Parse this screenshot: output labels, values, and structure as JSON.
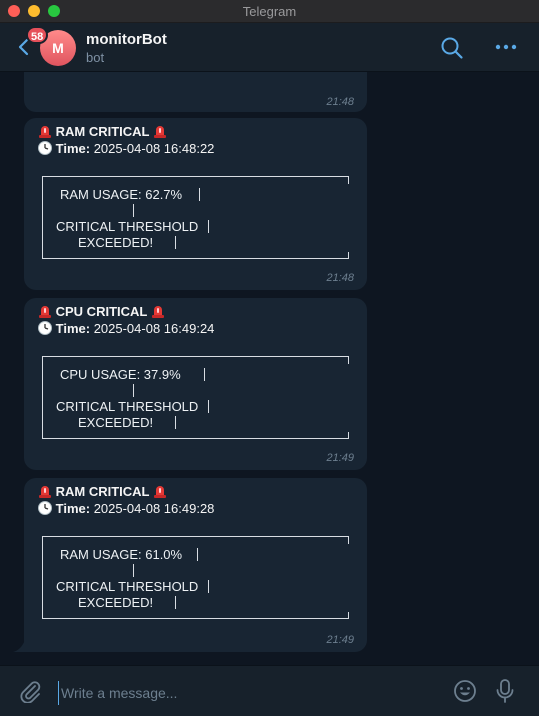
{
  "window": {
    "title": "Telegram"
  },
  "header": {
    "unread_count": "58",
    "avatar_letter": "M",
    "title": "monitorBot",
    "subtitle": "bot"
  },
  "colors": {
    "background": "#0e1621",
    "bubble": "#182533",
    "header": "#17212b",
    "accent": "#5aa9e6",
    "badge": "#e6505a",
    "alert": "#e53935"
  },
  "first_bubble": {
    "time": "21:48"
  },
  "messages": [
    {
      "title": "RAM CRITICAL",
      "time_label": "Time:",
      "time_value": "2025-04-08 16:48:22",
      "usage": "RAM USAGE: 62.7%",
      "threshold_1": "CRITICAL THRESHOLD",
      "threshold_2": "EXCEEDED!",
      "timestamp": "21:48"
    },
    {
      "title": "CPU CRITICAL",
      "time_label": "Time:",
      "time_value": "2025-04-08 16:49:24",
      "usage": "CPU USAGE: 37.9%",
      "threshold_1": "CRITICAL THRESHOLD",
      "threshold_2": "EXCEEDED!",
      "timestamp": "21:49"
    },
    {
      "title": "RAM CRITICAL",
      "time_label": "Time:",
      "time_value": "2025-04-08 16:49:28",
      "usage": "RAM USAGE: 61.0%",
      "threshold_1": "CRITICAL THRESHOLD",
      "threshold_2": "EXCEEDED!",
      "timestamp": "21:49"
    }
  ],
  "composer": {
    "placeholder": "Write a message..."
  }
}
